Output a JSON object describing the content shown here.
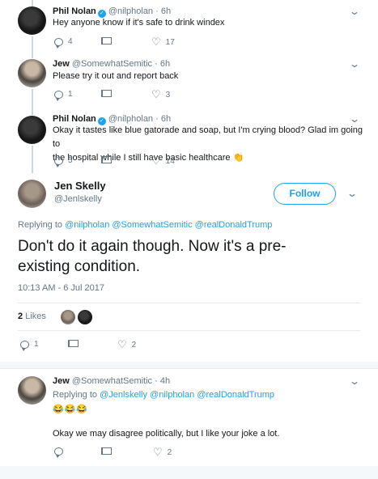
{
  "tweets": [
    {
      "name": "Phil Nolan",
      "handle": "@nilpholan",
      "dot": "·",
      "time": "6h",
      "text": "Hey anyone know if it's safe to drink windex",
      "replies": "4",
      "retweets": "",
      "likes": "17"
    },
    {
      "name": "Jew",
      "handle": "@SomewhatSemitic",
      "dot": "·",
      "time": "6h",
      "text": "Please try it out and report back",
      "replies": "1",
      "retweets": "",
      "likes": "3"
    },
    {
      "name": "Phil Nolan",
      "handle": "@nilpholan",
      "dot": "·",
      "time": "6h",
      "text_line1": "Okay it tastes like blue gatorade and soap, but I'm crying blood? Glad im going to",
      "text_line2": "the hospital while I still have basic healthcare",
      "emoji": "👏",
      "replies": "5",
      "retweets": "",
      "likes": "14"
    }
  ],
  "main": {
    "name": "Jen Skelly",
    "handle": "@Jenlskelly",
    "follow_label": "Follow",
    "replying_to_label": "Replying to",
    "replying_to": [
      "@nilpholan",
      "@SomewhatSemitic",
      "@realDonaldTrump"
    ],
    "text_line1": "Don't do it again though. Now it's a pre-",
    "text_line2": "existing condition.",
    "timestamp": "10:13 AM - 6 Jul 2017",
    "likes_count": "2",
    "likes_label": "Likes",
    "replies": "1",
    "retweets": "",
    "likes": "2"
  },
  "reply": {
    "name": "Jew",
    "handle": "@SomewhatSemitic",
    "dot": "·",
    "time": "4h",
    "replying_to_label": "Replying to",
    "replying_to": [
      "@Jenlskelly",
      "@nilpholan",
      "@realDonaldTrump"
    ],
    "emojis": "😂😂😂",
    "text": "Okay we may disagree politically, but I like your joke a lot.",
    "replies": "",
    "retweets": "",
    "likes": "2"
  },
  "icons": [
    "verified-icon",
    "chevron-down-icon",
    "reply-icon",
    "retweet-icon",
    "heart-icon"
  ],
  "colors": {
    "accent": "#1da1f2",
    "muted": "#657786",
    "divider": "#e6ecf0"
  }
}
